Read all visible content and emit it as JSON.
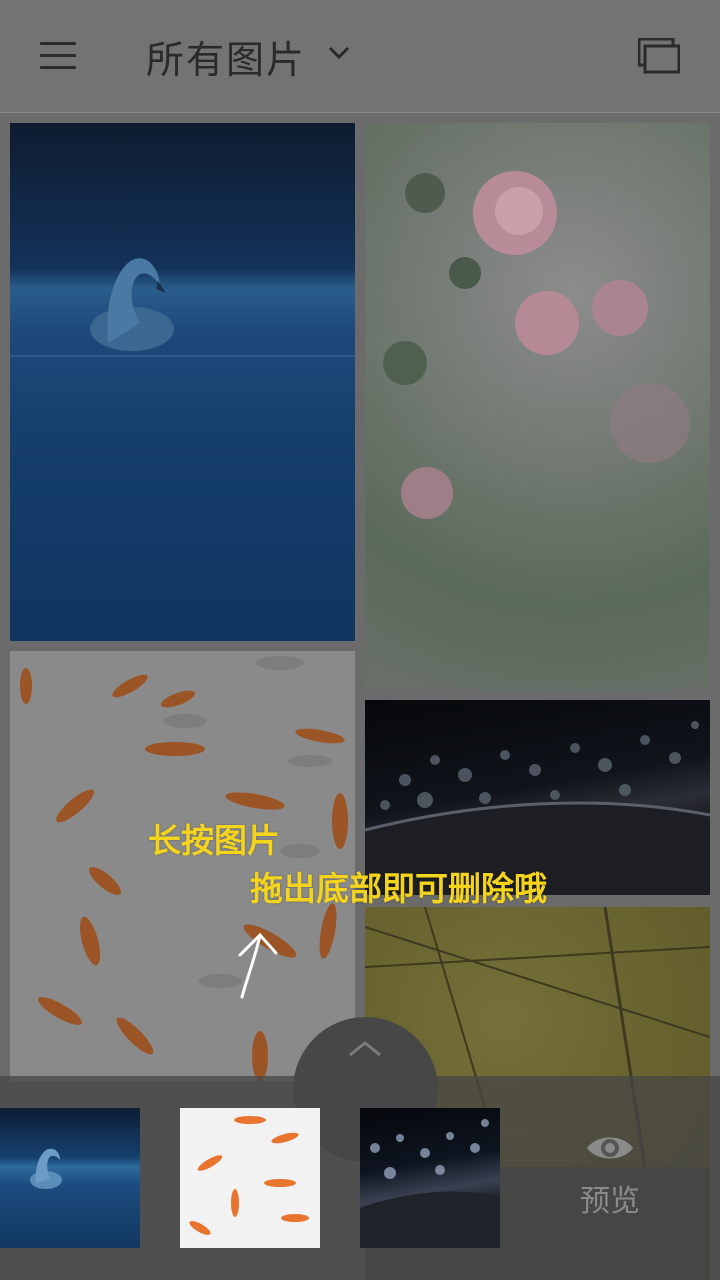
{
  "appbar": {
    "title": "所有图片",
    "menu_icon": "hamburger-menu-icon",
    "dropdown_icon": "chevron-down-icon",
    "window_icon": "overlapping-windows-icon"
  },
  "grid": {
    "tiles": [
      {
        "subject": "swan"
      },
      {
        "subject": "roses"
      },
      {
        "subject": "goldfish"
      },
      {
        "subject": "bokeh-lights"
      },
      {
        "subject": "ginkgo-trees"
      }
    ]
  },
  "hint": {
    "line1": "长按图片",
    "line2": "拖出底部即可删除哦",
    "color": "#f4d41c"
  },
  "tray": {
    "handle_icon": "chevron-up-icon",
    "thumbs": [
      {
        "subject": "swan"
      },
      {
        "subject": "goldfish"
      },
      {
        "subject": "bokeh-lights"
      }
    ],
    "preview_label": "预览",
    "preview_icon": "eye-icon"
  }
}
